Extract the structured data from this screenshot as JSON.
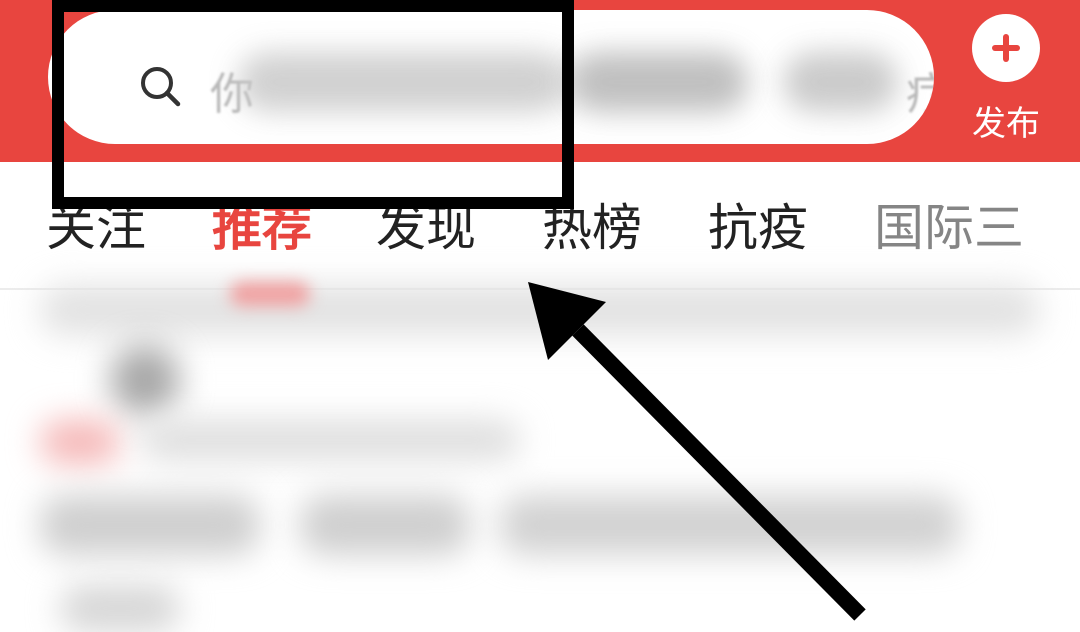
{
  "header": {
    "background_color": "#e8453f",
    "search": {
      "icon": "search-icon",
      "placeholder_lead": "你",
      "placeholder_trail": "疗"
    },
    "publish": {
      "icon": "plus-icon",
      "label": "发布"
    }
  },
  "tabs": [
    {
      "label": "关注",
      "active": false
    },
    {
      "label": "推荐",
      "active": true
    },
    {
      "label": "发现",
      "active": false
    },
    {
      "label": "热榜",
      "active": false
    },
    {
      "label": "抗疫",
      "active": false
    },
    {
      "label": "国际三",
      "active": false
    }
  ],
  "annotations": {
    "highlight_color": "#000000",
    "arrow_color": "#000000"
  }
}
